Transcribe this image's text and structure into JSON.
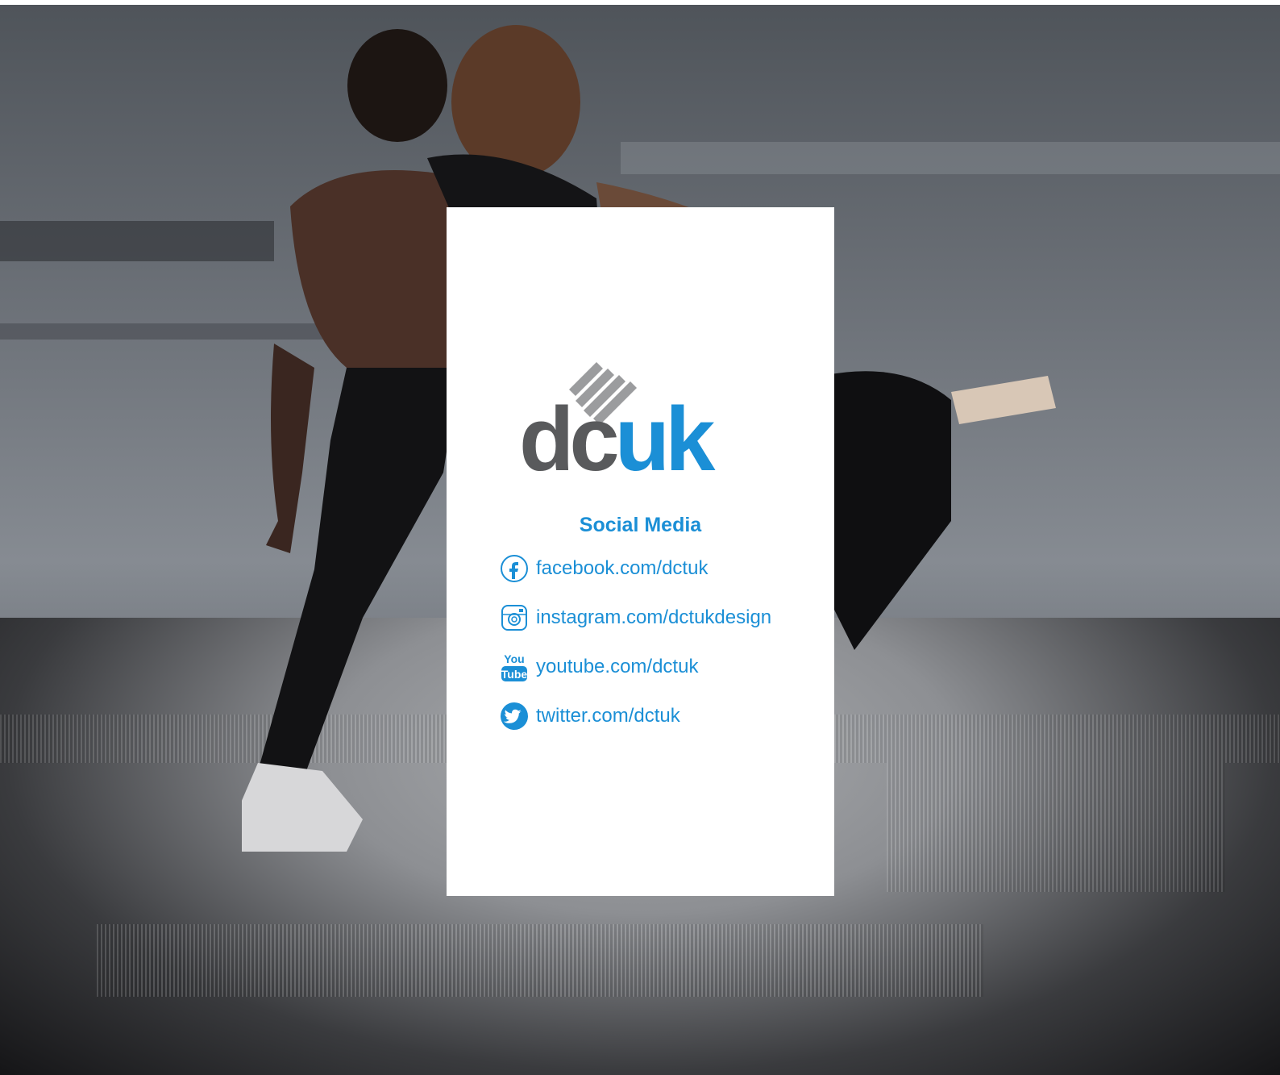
{
  "brand": {
    "logo_dark": "dc",
    "logo_accent": "uk",
    "accent_color": "#1b8fd6",
    "dark_color": "#595a5c"
  },
  "section": {
    "title": "Social Media"
  },
  "social": [
    {
      "icon": "facebook-icon",
      "label": "facebook.com/dctuk"
    },
    {
      "icon": "instagram-icon",
      "label": "instagram.com/dctukdesign"
    },
    {
      "icon": "youtube-icon",
      "label": "youtube.com/dctuk"
    },
    {
      "icon": "twitter-icon",
      "label": "twitter.com/dctuk"
    }
  ]
}
